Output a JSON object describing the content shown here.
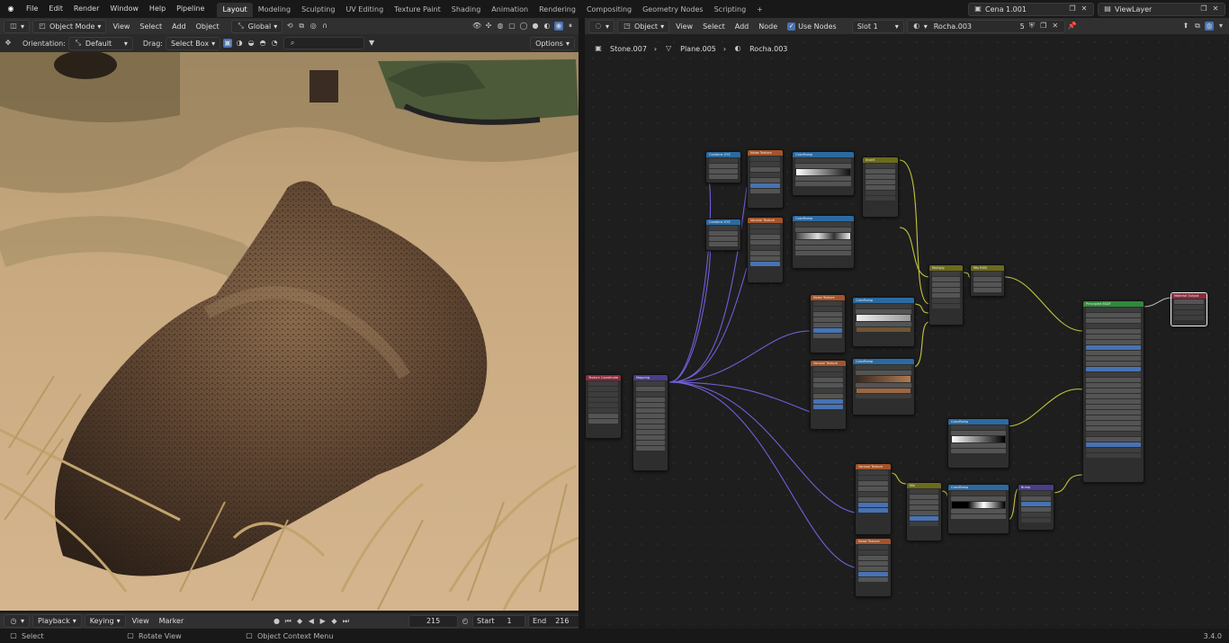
{
  "menubar": {
    "menus": [
      "File",
      "Edit",
      "Render",
      "Window",
      "Help",
      "Pipeline"
    ],
    "workspaces": [
      "Layout",
      "Modeling",
      "Sculpting",
      "UV Editing",
      "Texture Paint",
      "Shading",
      "Animation",
      "Rendering",
      "Compositing",
      "Geometry Nodes",
      "Scripting"
    ],
    "active_workspace": "Layout",
    "add_tab": "+",
    "scene": "Cena 1.001",
    "view_layer": "ViewLayer"
  },
  "viewport": {
    "mode": "Object Mode",
    "menus": [
      "View",
      "Select",
      "Add",
      "Object"
    ],
    "transform": "Global",
    "orientation_label": "Orientation:",
    "orientation_value": "Default",
    "drag_label": "Drag:",
    "drag_value": "Select Box",
    "options": "Options"
  },
  "node_editor": {
    "object_mode": "Object",
    "menus": [
      "View",
      "Select",
      "Add",
      "Node"
    ],
    "use_nodes_label": "Use Nodes",
    "slot": "Slot 1",
    "material": "Rocha.003",
    "users": "5",
    "breadcrumb": [
      "Stone.007",
      "Plane.005",
      "Rocha.003"
    ],
    "version": "3.4.0"
  },
  "nodes": [
    {
      "title": "Texture Coordinate",
      "color": "#8a2b3c"
    },
    {
      "title": "Mapping",
      "color": "#4a3d8c"
    },
    {
      "title": "Combine XYZ",
      "color": "#2b6aa1"
    },
    {
      "title": "Noise Texture",
      "color": "#a3542a"
    },
    {
      "title": "ColorRamp",
      "color": "#2b6aa1"
    },
    {
      "title": "Invert",
      "color": "#6b6b1c"
    },
    {
      "title": "Combine XYZ",
      "color": "#2b6aa1"
    },
    {
      "title": "Voronoi Texture",
      "color": "#a3542a"
    },
    {
      "title": "ColorRamp",
      "color": "#2b6aa1"
    },
    {
      "title": "Noise Texture",
      "color": "#a3542a"
    },
    {
      "title": "ColorRamp",
      "color": "#2b6aa1"
    },
    {
      "title": "Voronoi Texture",
      "color": "#a3542a"
    },
    {
      "title": "ColorRamp",
      "color": "#2b6aa1"
    },
    {
      "title": "Multiply",
      "color": "#6b6b1c"
    },
    {
      "title": "Mix RGB",
      "color": "#6b6b1c"
    },
    {
      "title": "Principled BSDF",
      "color": "#2f8a3a"
    },
    {
      "title": "Material Output",
      "color": "#8a2b3c"
    },
    {
      "title": "ColorRamp",
      "color": "#2b6aa1"
    },
    {
      "title": "Voronoi Texture",
      "color": "#a3542a"
    },
    {
      "title": "Mix",
      "color": "#6b6b1c"
    },
    {
      "title": "ColorRamp",
      "color": "#2b6aa1"
    },
    {
      "title": "Bump",
      "color": "#4a3d8c"
    },
    {
      "title": "Noise Texture",
      "color": "#a3542a"
    }
  ],
  "timeline": {
    "menus": [
      "Playback",
      "Keying",
      "View",
      "Marker"
    ],
    "current_frame": "215",
    "start_label": "Start",
    "start_value": "1",
    "end_label": "End",
    "end_value": "216"
  },
  "statusbar": {
    "items": [
      "Select",
      "Rotate View",
      "Object Context Menu"
    ]
  }
}
